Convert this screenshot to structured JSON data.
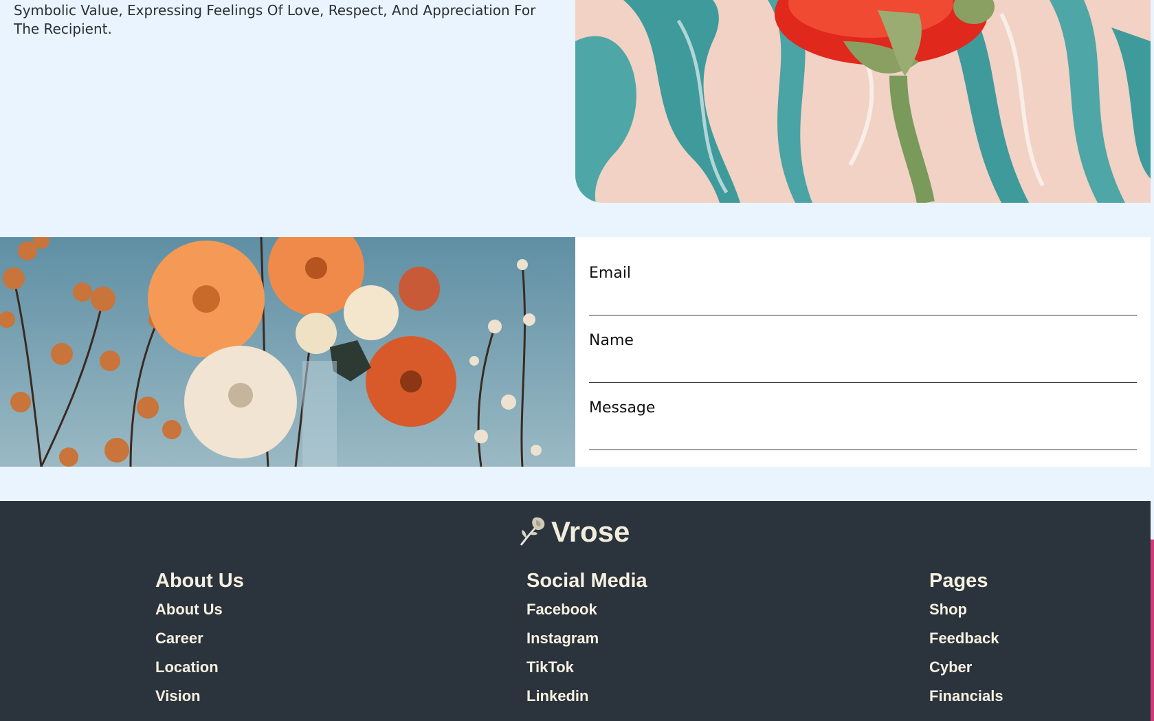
{
  "intro": {
    "text": "Symbolic Value, Expressing Feelings Of Love, Respect, And Appreciation For The Recipient."
  },
  "contact_form": {
    "email_label": "Email",
    "name_label": "Name",
    "message_label": "Message"
  },
  "footer": {
    "brand": "Vrose",
    "columns": [
      {
        "title": "About Us",
        "links": [
          "About Us",
          "Career",
          "Location",
          "Vision"
        ]
      },
      {
        "title": "Social Media",
        "links": [
          "Facebook",
          "Instagram",
          "TikTok",
          "Linkedin"
        ]
      },
      {
        "title": "Pages",
        "links": [
          "Shop",
          "Feedback",
          "Cyber",
          "Financials"
        ]
      }
    ]
  },
  "colors": {
    "page_background": "#e9f4fe",
    "footer_background": "#2b333c",
    "footer_text": "#f5f0e0",
    "accent": "#d23a7a"
  },
  "icons": {
    "brand_logo": "rose-icon"
  }
}
